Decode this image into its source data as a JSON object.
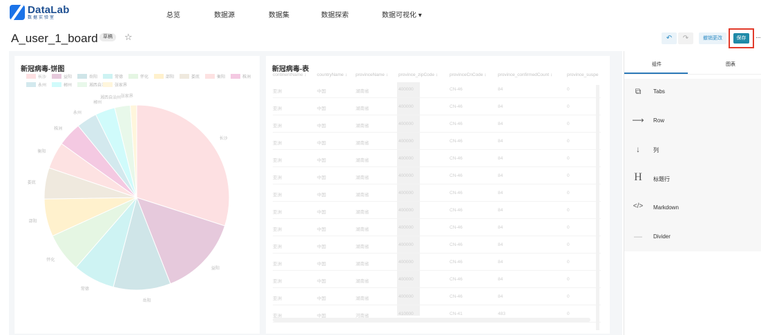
{
  "app": {
    "logo_main": "DataLab",
    "logo_sub": "数据实验室",
    "nav": [
      "总览",
      "数据源",
      "数据集",
      "数据探索",
      "数据可视化 ▾"
    ]
  },
  "board": {
    "title": "A_user_1_board",
    "status_badge": "草稿",
    "discard_label": "撤销更改",
    "save_label": "保存"
  },
  "pie_card": {
    "title": "新冠病毒-饼图",
    "visible_slice_labels": [
      "长沙",
      "益阳",
      "岳阳",
      "常德",
      "怀化",
      "邵阳",
      "娄底",
      "衡阳",
      "株洲",
      "永州",
      "郴州",
      "湘西自治州",
      "张家界"
    ]
  },
  "table_card": {
    "title": "新冠病毒-表",
    "columns": [
      "continentName",
      "countryName",
      "provinceName",
      "province_zipCode",
      "provinceCnCode",
      "province_confirmedCount",
      "province_suspe"
    ],
    "rows": [
      [
        "亚洲",
        "中国",
        "湖南省",
        "400000",
        "CN-46",
        "84",
        "0"
      ],
      [
        "亚洲",
        "中国",
        "湖南省",
        "400000",
        "CN-46",
        "84",
        "0"
      ],
      [
        "亚洲",
        "中国",
        "湖南省",
        "400000",
        "CN-46",
        "84",
        "0"
      ],
      [
        "亚洲",
        "中国",
        "湖南省",
        "400000",
        "CN-46",
        "84",
        "0"
      ],
      [
        "亚洲",
        "中国",
        "湖南省",
        "400000",
        "CN-46",
        "84",
        "0"
      ],
      [
        "亚洲",
        "中国",
        "湖南省",
        "400000",
        "CN-46",
        "84",
        "0"
      ],
      [
        "亚洲",
        "中国",
        "湖南省",
        "400000",
        "CN-46",
        "84",
        "0"
      ],
      [
        "亚洲",
        "中国",
        "湖南省",
        "400000",
        "CN-46",
        "84",
        "0"
      ],
      [
        "亚洲",
        "中国",
        "湖南省",
        "400000",
        "CN-46",
        "84",
        "0"
      ],
      [
        "亚洲",
        "中国",
        "湖南省",
        "400000",
        "CN-46",
        "84",
        "0"
      ],
      [
        "亚洲",
        "中国",
        "湖南省",
        "400000",
        "CN-46",
        "84",
        "0"
      ],
      [
        "亚洲",
        "中国",
        "湖南省",
        "400000",
        "CN-46",
        "84",
        "0"
      ],
      [
        "亚洲",
        "中国",
        "湖南省",
        "400000",
        "CN-46",
        "84",
        "0"
      ],
      [
        "亚洲",
        "中国",
        "河南省",
        "410000",
        "CN-41",
        "483",
        "0"
      ]
    ]
  },
  "panel": {
    "tabs": [
      "组件",
      "图表"
    ],
    "active_tab": "组件",
    "components": [
      {
        "label": "Tabs",
        "icon": "tabs-icon"
      },
      {
        "label": "Row",
        "icon": "arrow-right-icon"
      },
      {
        "label": "列",
        "icon": "arrow-down-icon"
      },
      {
        "label": "标题行",
        "icon": "heading-icon"
      },
      {
        "label": "Markdown",
        "icon": "code-icon"
      },
      {
        "label": "Divider",
        "icon": "divider-icon"
      }
    ]
  },
  "chart_data": {
    "type": "pie",
    "title": "新冠病毒-饼图",
    "legend_position": "top",
    "categories": [
      "长沙",
      "益阳",
      "岳阳",
      "常德",
      "怀化",
      "邵阳",
      "娄底",
      "衡阳",
      "株洲",
      "永州",
      "郴州",
      "湘西自治州",
      "张家界"
    ],
    "values": [
      242,
      114,
      81,
      59,
      55,
      53,
      44,
      38,
      34,
      29,
      28,
      22,
      9
    ],
    "colors": [
      "#fde0e2",
      "#e6c9dc",
      "#cfe5e8",
      "#cef3f3",
      "#e5f6e3",
      "#fff1cd",
      "#efe9de",
      "#fde2e2",
      "#f4c9e2",
      "#d3e9ee",
      "#d0fbfb",
      "#e8f8ea",
      "#fff6dc"
    ]
  }
}
